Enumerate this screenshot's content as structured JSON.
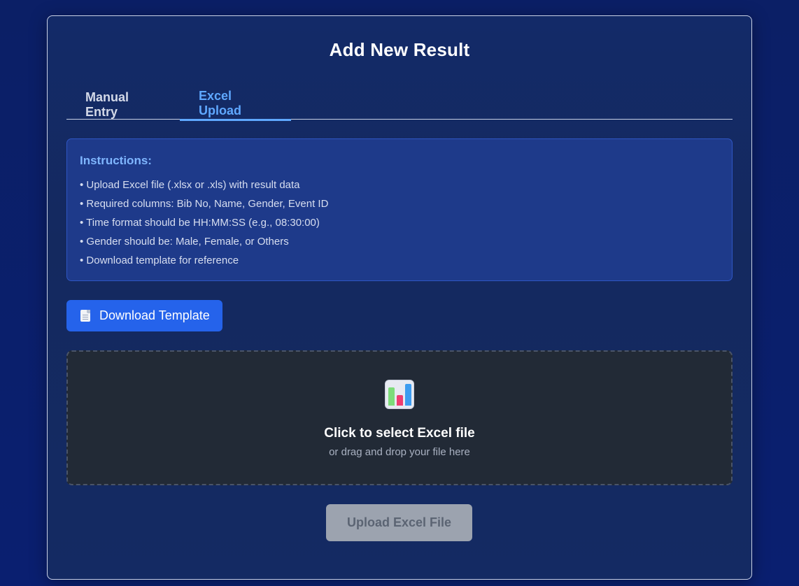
{
  "title": "Add New Result",
  "tabs": [
    {
      "label": "Manual Entry",
      "active": false
    },
    {
      "label": "Excel Upload",
      "active": true
    }
  ],
  "instructions": {
    "heading": "Instructions:",
    "items": [
      "• Upload Excel file (.xlsx or .xls) with result data",
      "• Required columns: Bib No, Name, Gender, Event ID",
      "• Time format should be HH:MM:SS (e.g., 08:30:00)",
      "• Gender should be: Male, Female, or Others",
      "• Download template for reference"
    ]
  },
  "download_button": {
    "label": "Download Template",
    "icon": "document-icon"
  },
  "dropzone": {
    "icon": "bar-chart-icon",
    "title": "Click to select Excel file",
    "subtitle": "or drag and drop your file here"
  },
  "upload_button": {
    "label": "Upload Excel File",
    "disabled": true
  },
  "colors": {
    "accent": "#5fa8ff",
    "primary_button": "#2563eb",
    "disabled_button": "#9ca3af"
  }
}
